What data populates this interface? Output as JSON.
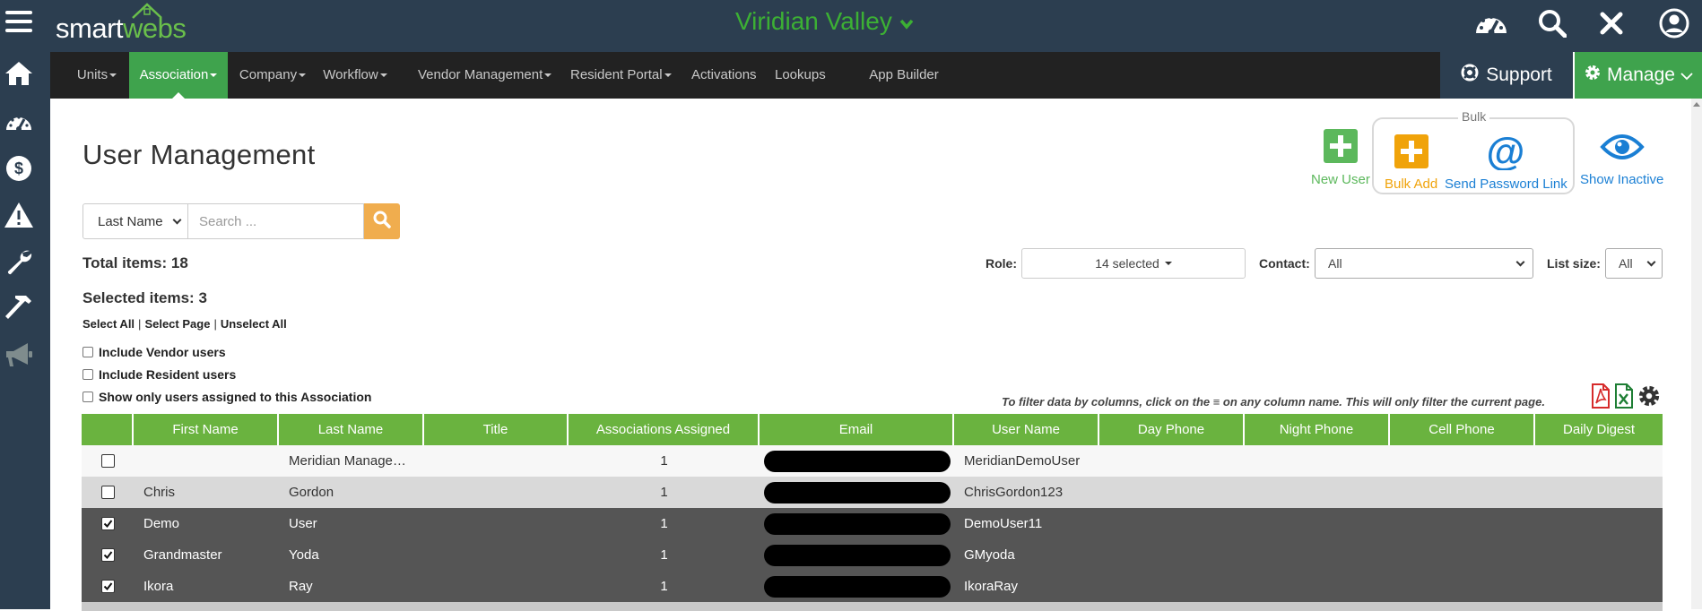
{
  "app": {
    "logo_part1": "smart",
    "logo_part2": "webs",
    "association_name": "Viridian Valley"
  },
  "sidebar": {
    "icons": [
      "menu-icon",
      "home-icon",
      "dashboard-icon",
      "dollar-icon",
      "warning-icon",
      "wrench-icon",
      "hammer-icon",
      "megaphone-icon"
    ]
  },
  "topbar": {
    "icons": [
      "dashboard-icon",
      "search-icon",
      "close-icon",
      "user-icon"
    ]
  },
  "nav": {
    "items": [
      {
        "label": "Units",
        "caret": true
      },
      {
        "label": "Association",
        "caret": true,
        "active": true
      },
      {
        "label": "Company",
        "caret": true
      },
      {
        "label": "Workflow",
        "caret": true
      },
      {
        "label": "Vendor Management",
        "caret": true
      },
      {
        "label": "Resident Portal",
        "caret": true
      },
      {
        "label": "Activations",
        "caret": false
      },
      {
        "label": "Lookups",
        "caret": false
      },
      {
        "label": "App Builder",
        "caret": false
      }
    ],
    "support_label": "Support",
    "manage_label": "Manage"
  },
  "page": {
    "title": "User Management"
  },
  "actions": {
    "new_user": "New User",
    "bulk_group_label": "Bulk",
    "bulk_add": "Bulk Add",
    "send_password_link": "Send Password Link",
    "show_inactive": "Show Inactive",
    "colors": {
      "green": "#5cb85c",
      "orange": "#f0a30a",
      "blue": "#1a7fd4"
    }
  },
  "search": {
    "field_selected": "Last Name",
    "placeholder": "Search ..."
  },
  "summary": {
    "total_items": "Total items: 18",
    "selected_items": "Selected items: 3",
    "select_all": "Select All",
    "select_page": "Select Page",
    "unselect_all": "Unselect All"
  },
  "options": {
    "include_vendor": "Include Vendor users",
    "include_resident": "Include Resident users",
    "assigned_only": "Show only users assigned to this Association"
  },
  "filters": {
    "role_label": "Role:",
    "role_value": "14 selected",
    "contact_label": "Contact:",
    "contact_value": "All",
    "list_size_label": "List size:",
    "list_size_value": "All",
    "hint": "To filter data by columns, click on the ≡ on any column name. This will only filter the current page."
  },
  "table": {
    "columns": [
      "",
      "First Name",
      "Last Name",
      "Title",
      "Associations Assigned",
      "Email",
      "User Name",
      "Day Phone",
      "Night Phone",
      "Cell Phone",
      "Daily Digest"
    ],
    "rows": [
      {
        "checked": false,
        "first": "",
        "last": "Meridian Manage…",
        "title": "",
        "assoc": "1",
        "username": "MeridianDemoUser",
        "style": "r-light"
      },
      {
        "checked": false,
        "first": "Chris",
        "last": "Gordon",
        "title": "",
        "assoc": "1",
        "username": "ChrisGordon123",
        "style": "r-gray"
      },
      {
        "checked": true,
        "first": "Demo",
        "last": "User",
        "title": "",
        "assoc": "1",
        "username": "DemoUser11",
        "style": "r-dark"
      },
      {
        "checked": true,
        "first": "Grandmaster",
        "last": "Yoda",
        "title": "",
        "assoc": "1",
        "username": "GMyoda",
        "style": "r-dark"
      },
      {
        "checked": true,
        "first": "Ikora",
        "last": "Ray",
        "title": "",
        "assoc": "1",
        "username": "IkoraRay",
        "style": "r-dark"
      }
    ]
  }
}
